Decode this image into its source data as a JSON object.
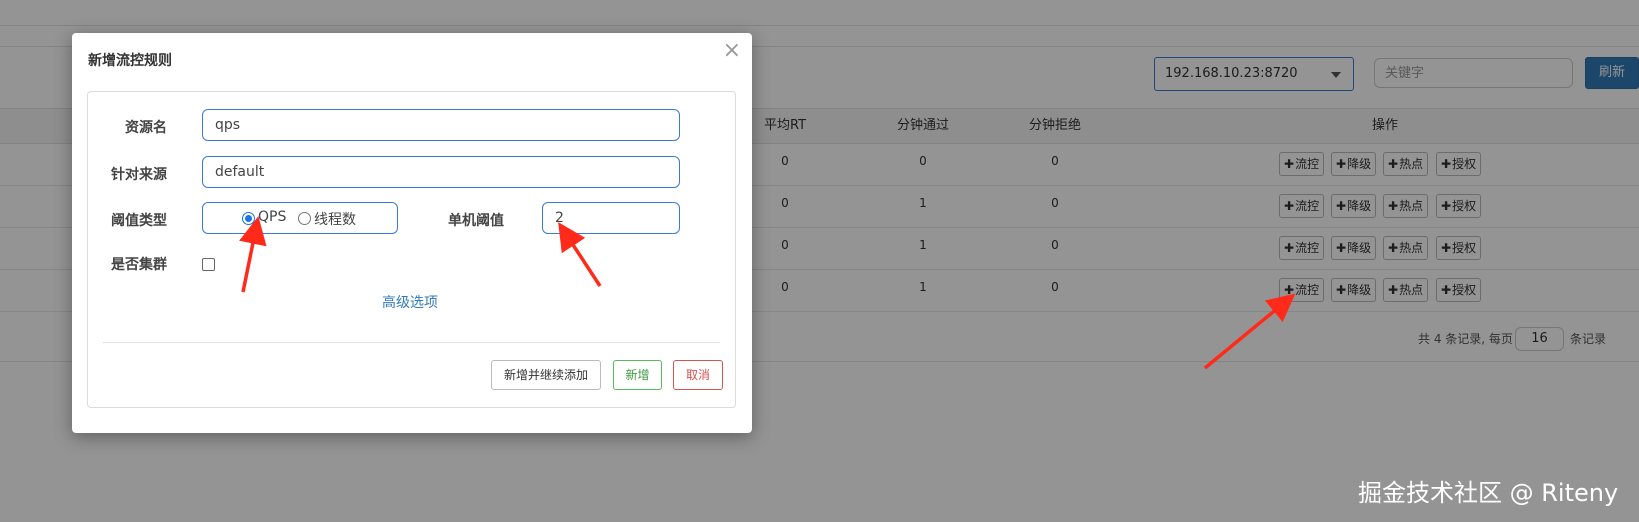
{
  "background": {
    "app_select": {
      "value": "192.168.10.23:8720"
    },
    "search": {
      "placeholder": "关键字"
    },
    "refresh_label": "刷新",
    "table": {
      "headers": [
        "平均RT",
        "分钟通过",
        "分钟拒绝",
        "操作"
      ],
      "rows": [
        {
          "avg_rt": "0",
          "pass": "0",
          "block": "0"
        },
        {
          "avg_rt": "0",
          "pass": "1",
          "block": "0"
        },
        {
          "avg_rt": "0",
          "pass": "1",
          "block": "0"
        },
        {
          "avg_rt": "0",
          "pass": "1",
          "block": "0"
        }
      ],
      "row_actions": [
        "流控",
        "降级",
        "热点",
        "授权"
      ],
      "plus_glyph": "✚"
    },
    "pagination": {
      "prefix": "共 4 条记录, 每页",
      "page_size": "16",
      "suffix": "条记录"
    }
  },
  "modal": {
    "title": "新增流控规则",
    "close_glyph": "×",
    "fields": {
      "resource_label": "资源名",
      "resource_value": "qps",
      "limit_app_label": "针对来源",
      "limit_app_value": "default",
      "grade_label": "阈值类型",
      "grade_options": [
        "QPS",
        "线程数"
      ],
      "grade_selected": "QPS",
      "threshold_label": "单机阈值",
      "threshold_value": "2",
      "cluster_label": "是否集群",
      "cluster_checked": false
    },
    "advanced_label": "高级选项",
    "buttons": {
      "add_and_continue": "新增并继续添加",
      "add": "新增",
      "cancel": "取消"
    }
  },
  "annotation_color": "#ff2a1a",
  "watermark": "掘金技术社区 @ Riteny"
}
